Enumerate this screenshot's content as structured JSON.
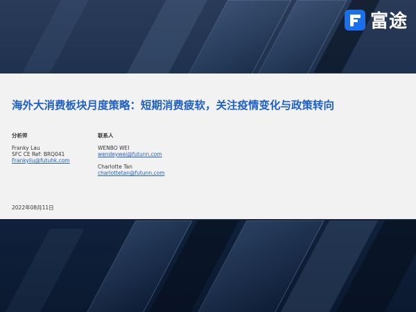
{
  "brand": {
    "logo_text": "富途",
    "logo_color": "#1b6fe8"
  },
  "title": "海外大消费板块月度策略：短期消费疲软，关注疫情变化与政策转向",
  "analysts": {
    "heading": "分析师",
    "name": "Franky Lau",
    "license": "SFC CE Ref: BRQ041",
    "email": "Frankyliu@futuhk.com"
  },
  "contacts": {
    "heading": "联系人",
    "people": [
      {
        "name": "WENBO WEI",
        "email": "wendeywei@futunn.com"
      },
      {
        "name": "Charlotte Tan",
        "email": "charlottetan@futunn.com"
      }
    ]
  },
  "date": "2022年08月11日",
  "colors": {
    "title": "#1d5fc9",
    "band": "#f2f2f2",
    "background": "#0e1c33"
  }
}
